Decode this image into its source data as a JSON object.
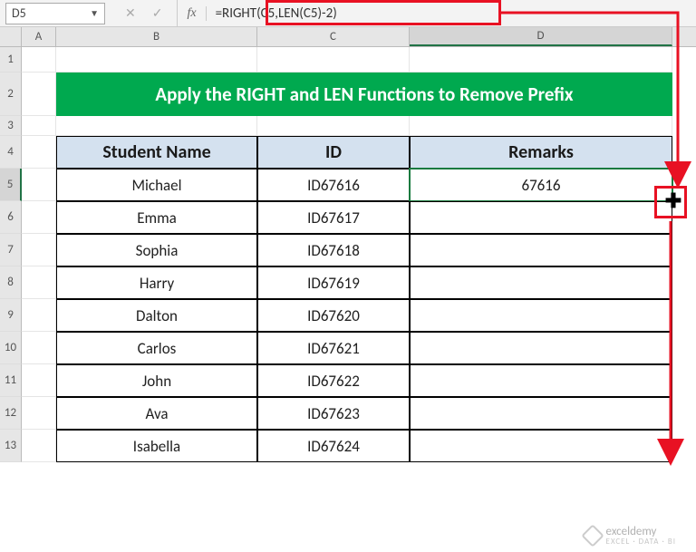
{
  "nameBox": {
    "value": "D5"
  },
  "formulaBar": {
    "fxLabel": "fx",
    "formula": "=RIGHT(C5,LEN(C5)-2)"
  },
  "columns": {
    "A": "A",
    "B": "B",
    "C": "C",
    "D": "D",
    "selected": "D"
  },
  "rows": {
    "labels": [
      "1",
      "2",
      "3",
      "4",
      "5",
      "6",
      "7",
      "8",
      "9",
      "10",
      "11",
      "12",
      "13"
    ],
    "selected": "5"
  },
  "title": "Apply the RIGHT and LEN Functions to Remove Prefix",
  "tableHead": {
    "name": "Student Name",
    "id": "ID",
    "remarks": "Remarks"
  },
  "table": [
    {
      "name": "Michael",
      "id": "ID67616",
      "remarks": "67616"
    },
    {
      "name": "Emma",
      "id": "ID67617",
      "remarks": ""
    },
    {
      "name": "Sophia",
      "id": "ID67618",
      "remarks": ""
    },
    {
      "name": "Harry",
      "id": "ID67619",
      "remarks": ""
    },
    {
      "name": "Dalton",
      "id": "ID67620",
      "remarks": ""
    },
    {
      "name": "Carlos",
      "id": "ID67621",
      "remarks": ""
    },
    {
      "name": "John",
      "id": "ID67622",
      "remarks": ""
    },
    {
      "name": "Ava",
      "id": "ID67623",
      "remarks": ""
    },
    {
      "name": "Isabella",
      "id": "ID67624",
      "remarks": ""
    }
  ],
  "watermark": {
    "brand": "exceldemy",
    "sub": "EXCEL · DATA · BI"
  },
  "colors": {
    "titleBg": "#00a94f",
    "headerBg": "#d4e1ef",
    "annotation": "#e81123",
    "selection": "#1a7a3f"
  }
}
